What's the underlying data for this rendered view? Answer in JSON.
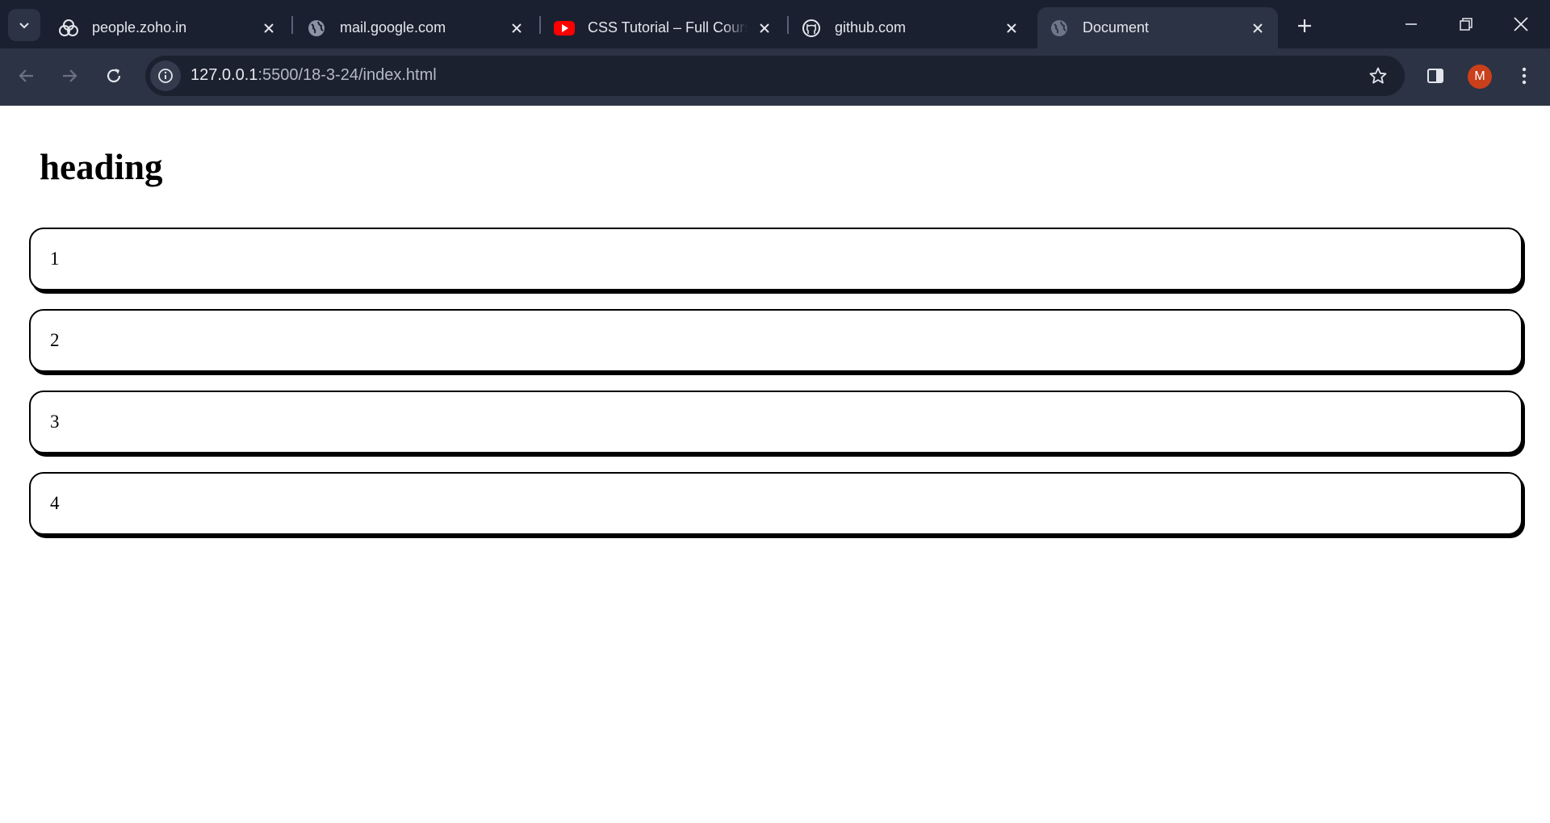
{
  "browser": {
    "tabs": [
      {
        "title": "people.zoho.in",
        "icon": "zoho-icon"
      },
      {
        "title": "mail.google.com",
        "icon": "globe-icon"
      },
      {
        "title": "CSS Tutorial – Full Course",
        "icon": "youtube-icon"
      },
      {
        "title": "github.com",
        "icon": "github-icon"
      },
      {
        "title": "Document",
        "icon": "globe-icon",
        "active": true
      }
    ],
    "url_host": "127.0.0.1",
    "url_rest": ":5500/18-3-24/index.html",
    "profile_initial": "M",
    "colors": {
      "tabbar": "#1b2030",
      "toolbar": "#2c3344",
      "avatar": "#c9401b",
      "youtube": "#ff0000"
    }
  },
  "page": {
    "heading": "heading",
    "cards": [
      "1",
      "2",
      "3",
      "4"
    ]
  }
}
